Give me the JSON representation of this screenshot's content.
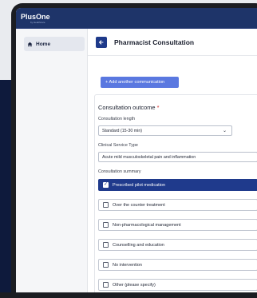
{
  "app": {
    "brand": "PlusOne",
    "brand_sub": "by Healthcare"
  },
  "sidebar": {
    "items": [
      {
        "label": "Home",
        "icon": "home-icon",
        "active": true
      }
    ]
  },
  "header": {
    "title": "Pharmacist Consultation",
    "back_icon": "arrow-left-icon"
  },
  "actions": {
    "add_communication": "+ Add another communication"
  },
  "form": {
    "section_title": "Consultation outcome",
    "required_mark": "*",
    "length_label": "Consultation length",
    "length_value": "Standard (15-30 min)",
    "service_label": "Clinical Service Type",
    "service_value": "Acute mild musculoskeletal pain and inflammation",
    "summary_label": "Consultation summary",
    "options": [
      {
        "label": "Prescribed pilot medication",
        "checked": true
      },
      {
        "label": "Over the counter treatment",
        "checked": false
      },
      {
        "label": "Non-pharmacological management",
        "checked": false
      },
      {
        "label": "Counselling and education",
        "checked": false
      },
      {
        "label": "No intervention",
        "checked": false
      },
      {
        "label": "Other (please specify)",
        "checked": false
      }
    ]
  },
  "colors": {
    "topbar": "#1e3469",
    "primary": "#1f3a8c",
    "add_button": "#5a78e0",
    "required": "#d12d2d"
  }
}
